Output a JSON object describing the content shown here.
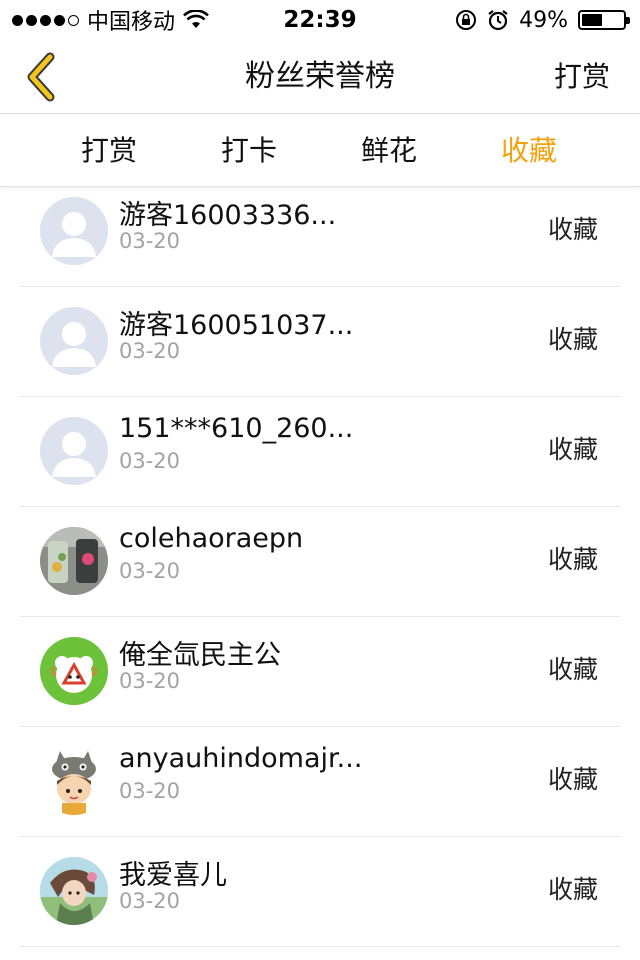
{
  "status_bar": {
    "carrier": "中国移动",
    "time": "22:39",
    "battery": "49%",
    "battery_level": 0.49,
    "icons": [
      "signal-dots-icon",
      "wifi-icon",
      "orientation-lock-icon",
      "alarm-icon",
      "battery-icon"
    ]
  },
  "nav": {
    "back_icon": "chevron-left-icon",
    "title": "粉丝荣誉榜",
    "right_label": "打赏",
    "accent_color": "#f3c61c"
  },
  "tabs": [
    {
      "label": "打赏",
      "active": false
    },
    {
      "label": "打卡",
      "active": false
    },
    {
      "label": "鲜花",
      "active": false
    },
    {
      "label": "收藏",
      "active": true
    }
  ],
  "active_tab_color": "#f3a20e",
  "list": [
    {
      "name": "游客16003336...",
      "date": "03-20",
      "action": "收藏",
      "avatar": "default-avatar-icon"
    },
    {
      "name": "游客160051037...",
      "date": "03-20",
      "action": "收藏",
      "avatar": "default-avatar-icon"
    },
    {
      "name": "151***610_260...",
      "date": "03-20",
      "action": "收藏",
      "avatar": "default-avatar-icon"
    },
    {
      "name": "colehaoraepn",
      "date": "03-20",
      "action": "收藏",
      "avatar": "photo-avatar"
    },
    {
      "name": "俺全氙民主公",
      "date": "03-20",
      "action": "收藏",
      "avatar": "cartoon-avatar-green"
    },
    {
      "name": "anyauhindomajr...",
      "date": "03-20",
      "action": "收藏",
      "avatar": "cartoon-avatar-totoro"
    },
    {
      "name": "我爱喜儿",
      "date": "03-20",
      "action": "收藏",
      "avatar": "anime-avatar"
    }
  ]
}
